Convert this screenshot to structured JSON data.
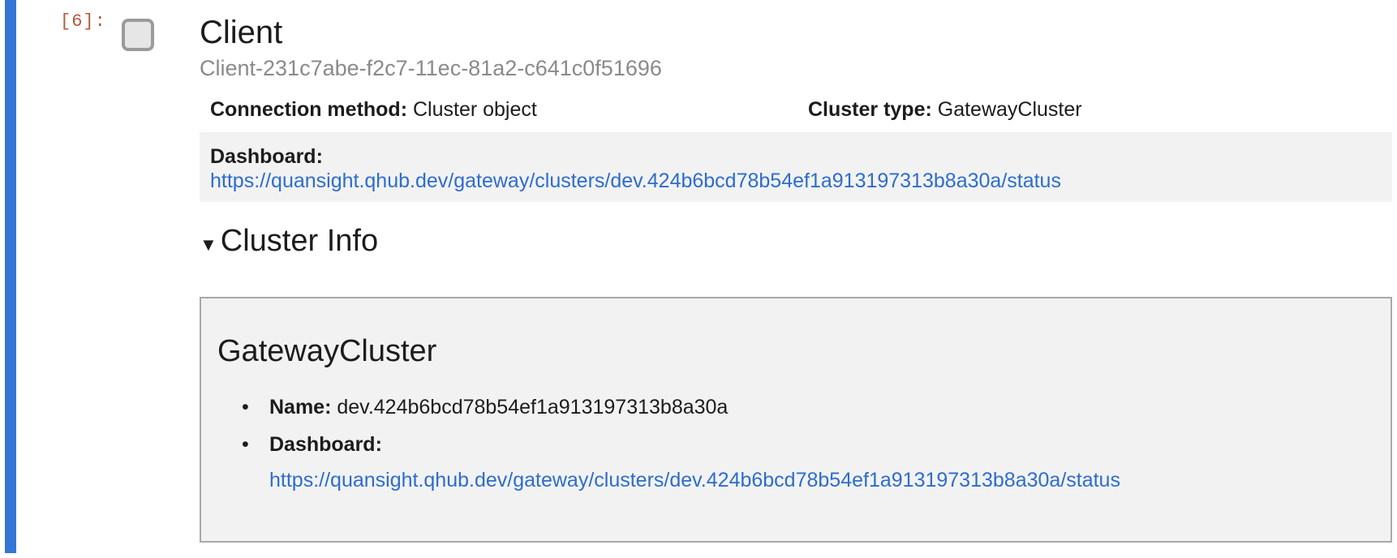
{
  "cell": {
    "prompt": "[6]:"
  },
  "client": {
    "title": "Client",
    "id": "Client-231c7abe-f2c7-11ec-81a2-c641c0f51696",
    "connection_method_label": "Connection method:",
    "connection_method_value": "Cluster object",
    "cluster_type_label": "Cluster type:",
    "cluster_type_value": "GatewayCluster",
    "dashboard_label": "Dashboard:",
    "dashboard_url": "https://quansight.qhub.dev/gateway/clusters/dev.424b6bcd78b54ef1a913197313b8a30a/status"
  },
  "cluster_info": {
    "summary_label": "Cluster Info",
    "caret_icon": "▼",
    "heading": "GatewayCluster",
    "name_label": "Name:",
    "name_value": "dev.424b6bcd78b54ef1a913197313b8a30a",
    "dashboard_label": "Dashboard:",
    "dashboard_url": "https://quansight.qhub.dev/gateway/clusters/dev.424b6bcd78b54ef1a913197313b8a30a/status",
    "bullet": "•"
  },
  "colors": {
    "active_bar": "#3376d6",
    "prompt": "#b45a3c",
    "link": "#2d6dcc",
    "panel_bg": "#f2f2f2"
  }
}
